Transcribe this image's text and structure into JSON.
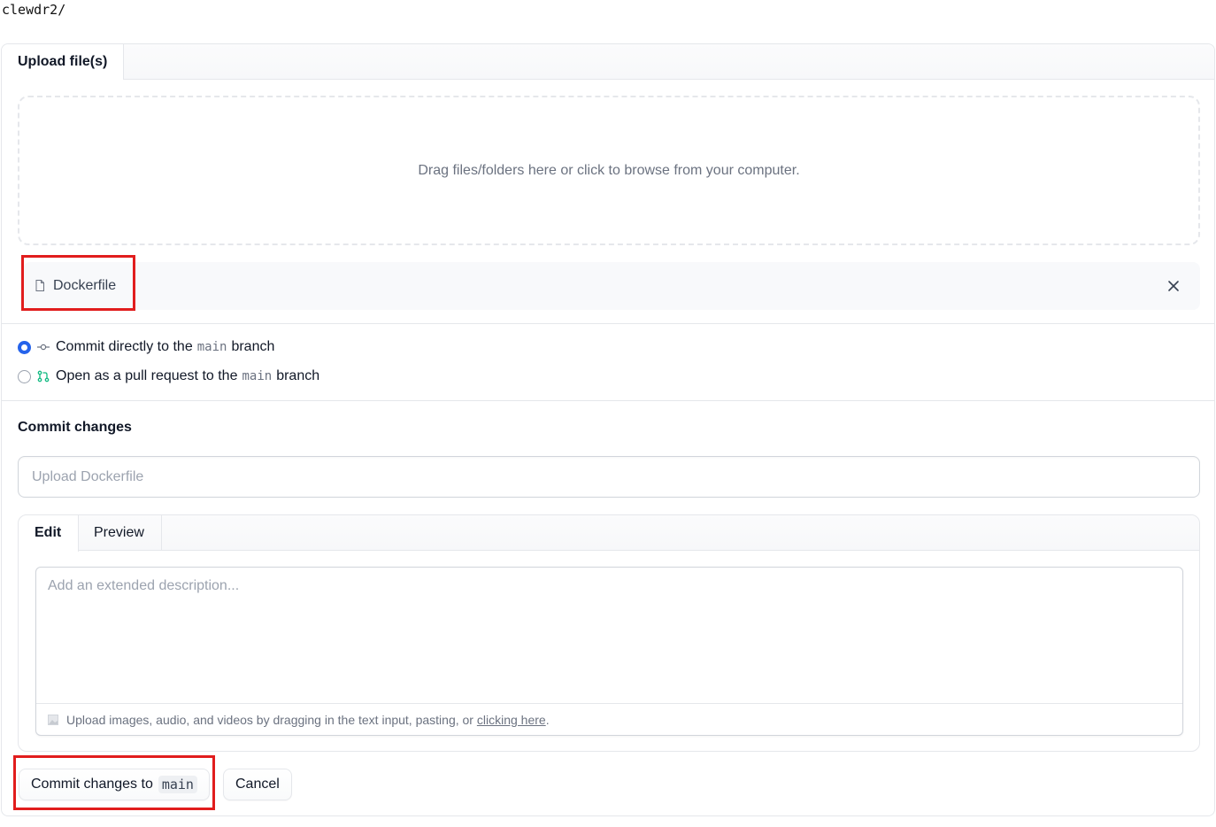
{
  "breadcrumb": "clewdr2/",
  "upload_tab": {
    "label": "Upload file(s)"
  },
  "dropzone": {
    "text": "Drag files/folders here or click to browse from your computer."
  },
  "file": {
    "name": "Dockerfile",
    "icon": "file-icon",
    "remove_icon": "close-icon"
  },
  "commit_options": [
    {
      "prefix": "Commit directly to the",
      "branch": "main",
      "suffix": "branch",
      "checked": true,
      "icon": "commit-icon"
    },
    {
      "prefix": "Open as a pull request to the",
      "branch": "main",
      "suffix": "branch",
      "checked": false,
      "icon": "pull-request-icon"
    }
  ],
  "commit_section": {
    "title": "Commit changes",
    "summary_placeholder": "Upload Dockerfile",
    "tabs": [
      "Edit",
      "Preview"
    ],
    "description_placeholder": "Add an extended description...",
    "footer_text": "Upload images, audio, and videos by dragging in the text input, pasting, or",
    "footer_link": "clicking here",
    "footer_end": "."
  },
  "actions": {
    "commit_label": "Commit changes to",
    "commit_branch": "main",
    "cancel_label": "Cancel"
  },
  "colors": {
    "highlight": "#e11d1d",
    "radio_checked": "#2563eb",
    "pr_icon": "#10b981"
  }
}
